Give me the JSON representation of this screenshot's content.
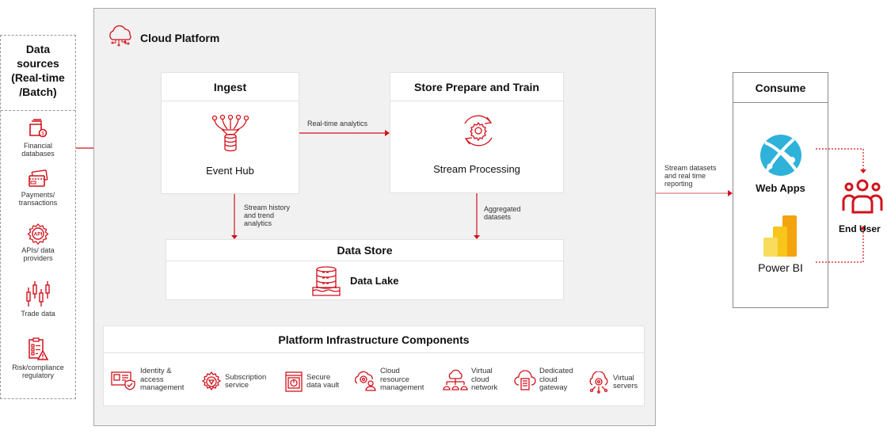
{
  "colors": {
    "accent": "#d1121c",
    "panel_bg": "#f1f1f1",
    "azure_blue": "#2fb2d9",
    "powerbi_yellow": "#f2c811"
  },
  "sources": {
    "title_lines": [
      "Data",
      "sources",
      "(Real-time",
      "/Batch)"
    ],
    "items": [
      {
        "icon": "financial-database-icon",
        "lines": [
          "Financial",
          "databases"
        ]
      },
      {
        "icon": "payment-cards-icon",
        "lines": [
          "Payments/",
          "transactions"
        ]
      },
      {
        "icon": "api-gear-icon",
        "lines": [
          "APIs/ data",
          "providers"
        ]
      },
      {
        "icon": "candlestick-chart-icon",
        "lines": [
          "Trade data"
        ]
      },
      {
        "icon": "compliance-clipboard-icon",
        "lines": [
          "Risk/compliance",
          "regulatory"
        ]
      }
    ]
  },
  "platform": {
    "title": "Cloud Platform",
    "ingest": {
      "title": "Ingest",
      "label": "Event Hub"
    },
    "store_prepare": {
      "title": "Store Prepare and Train",
      "label": "Stream Processing"
    },
    "data_store": {
      "title": "Data Store",
      "label": "Data Lake"
    },
    "edges": {
      "realtime": "Real-time analytics",
      "history_lines": [
        "Stream history",
        "and trend",
        "analytics"
      ],
      "aggregated_lines": [
        "Aggregated",
        "datasets"
      ]
    },
    "infra": {
      "title": "Platform Infrastructure Components",
      "items": [
        {
          "icon": "identity-card-shield-icon",
          "lines": [
            "Identity &",
            "access",
            "management"
          ]
        },
        {
          "icon": "subscription-gear-icon",
          "lines": [
            "Subscription",
            "service"
          ]
        },
        {
          "icon": "vault-icon",
          "lines": [
            "Secure",
            "data vault"
          ]
        },
        {
          "icon": "cloud-resource-icon",
          "lines": [
            "Cloud",
            "resource",
            "management"
          ]
        },
        {
          "icon": "cloud-network-icon",
          "lines": [
            "Virtual",
            "cloud",
            "network"
          ]
        },
        {
          "icon": "cloud-gateway-icon",
          "lines": [
            "Dedicated",
            "cloud",
            "gateway"
          ]
        },
        {
          "icon": "virtual-server-icon",
          "lines": [
            "Virtual",
            "servers"
          ]
        }
      ]
    }
  },
  "consume": {
    "edge_lines": [
      "Stream datasets",
      "and real time",
      "reporting"
    ],
    "title": "Consume",
    "web_apps": "Web Apps",
    "power_bi": "Power BI"
  },
  "end_user": {
    "label": "End User"
  }
}
